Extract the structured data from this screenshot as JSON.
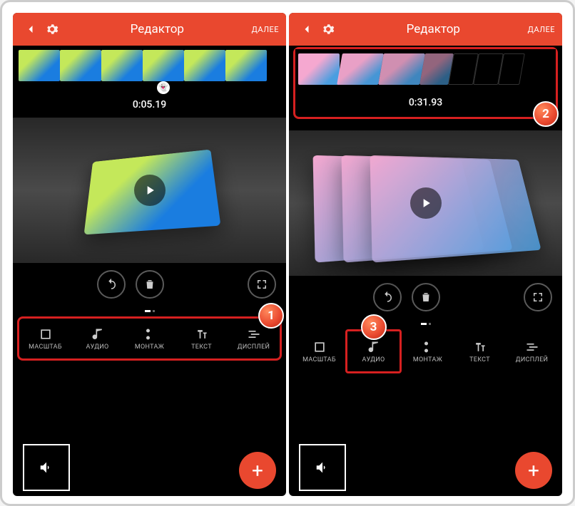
{
  "header": {
    "title": "Редактор",
    "next": "ДАЛЕЕ"
  },
  "left": {
    "timestamp": "0:05.19"
  },
  "right": {
    "timestamp": "0:31.93"
  },
  "tools": {
    "scale": "МАСШТАБ",
    "audio": "АУДИО",
    "montage": "МОНТАЖ",
    "text": "ТЕКСТ",
    "display": "ДИСПЛЕЙ"
  },
  "annotations": {
    "a1": "1",
    "a2": "2",
    "a3": "3"
  },
  "fab": "+"
}
